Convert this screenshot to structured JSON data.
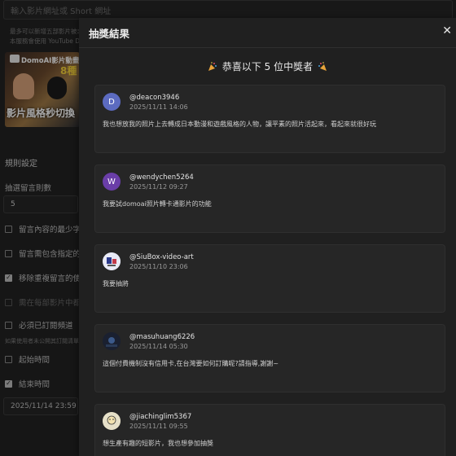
{
  "background": {
    "url_input_placeholder": "輸入影片網址或 Short 網址",
    "hint_line1": "最多可以新增五部影片被念",
    "hint_line2": "本服務會使用 YouTube Dat",
    "thumbnail": {
      "brand_text": "DomoAI影片動畫天刊",
      "badge_text": "8種",
      "caption": "影片風格秒切換"
    },
    "section_title": "規則設定",
    "draw_count_label": "抽選留言則數",
    "draw_count_value": "5",
    "options": [
      {
        "label": "留言內容的最少字",
        "checked": false,
        "enabled": true
      },
      {
        "label": "留言需包含指定的",
        "checked": false,
        "enabled": true
      },
      {
        "label": "移除重複留言的使",
        "checked": true,
        "enabled": true
      },
      {
        "label": "需在每部影片中都",
        "checked": false,
        "enabled": false
      },
      {
        "label": "必須已訂閱頻道",
        "checked": false,
        "enabled": true
      }
    ],
    "subscribe_note": "如果使用者未公開其訂閱清單",
    "start_time_label": "起始時間",
    "start_time_checked": false,
    "end_time_label": "結束時間",
    "end_time_checked": true,
    "end_time_value": "2025/11/14 23:59"
  },
  "modal": {
    "title": "抽獎結果",
    "close_icon": "close-icon",
    "headline": "恭喜以下 5 位中獎者",
    "winners": [
      {
        "username": "@deacon3946",
        "time": "2025/11/11 14:06",
        "comment": "我也想放我的照片上去轉成日本動漫和遊戲風格的人物，讓平素的照片活起來，看起來就很好玩",
        "avatar_letter": "D",
        "avatar_color": "#5c6bc0"
      },
      {
        "username": "@wendychen5264",
        "time": "2025/11/12 09:27",
        "comment": "我要試domoai照片轉卡通影片的功能",
        "avatar_letter": "W",
        "avatar_color": "#6a3ea8"
      },
      {
        "username": "@SiuBox-video-art",
        "time": "2025/11/10 23:06",
        "comment": "我要抽將",
        "avatar_letter": "",
        "avatar_color": "#e8eaf6"
      },
      {
        "username": "@masuhuang6226",
        "time": "2025/11/14 05:30",
        "comment": "這個付費機制沒有信用卡,在台灣要如何訂購呢?請指導,謝謝~",
        "avatar_letter": "",
        "avatar_color": "#1a2030"
      },
      {
        "username": "@jiachinglim5367",
        "time": "2025/11/11 09:55",
        "comment": "想生產有趣的短影片，我也想參加抽獎",
        "avatar_letter": "",
        "avatar_color": "#e6e0c8"
      }
    ]
  }
}
